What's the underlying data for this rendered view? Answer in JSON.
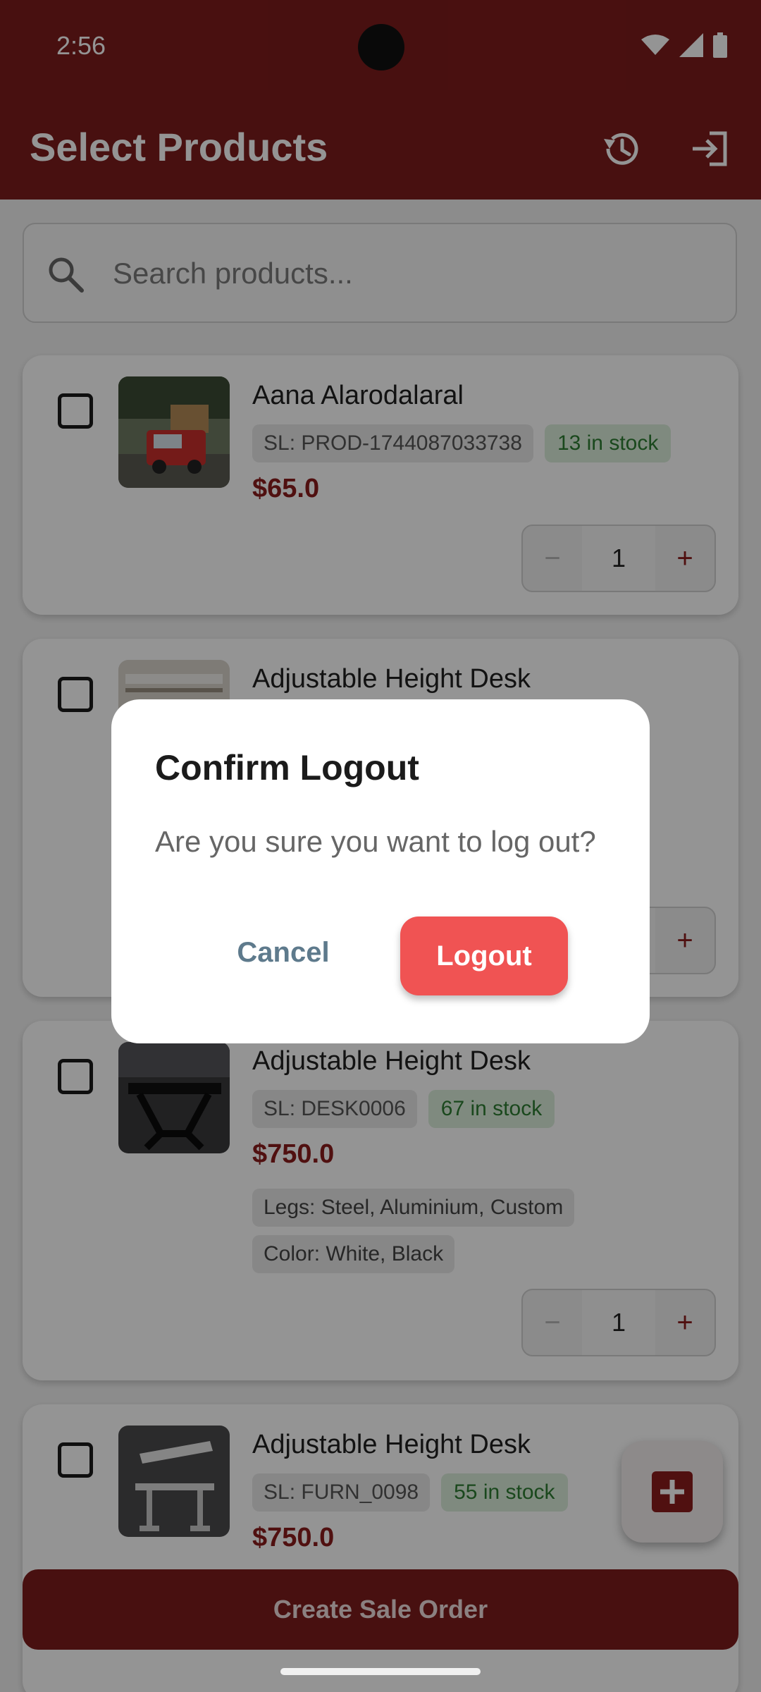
{
  "status_bar": {
    "time": "2:56"
  },
  "app_bar": {
    "title": "Select Products",
    "history_icon": "history-icon",
    "logout_icon": "logout-icon"
  },
  "search": {
    "placeholder": "Search products..."
  },
  "products": [
    {
      "name": "Aana Alarodalaral",
      "sl": "SL: PROD-1744087033738",
      "stock": "13 in stock",
      "price": "$65.0",
      "quantity": "1",
      "attributes": []
    },
    {
      "name": "Adjustable Height Desk",
      "sl": "",
      "stock": "",
      "price": "",
      "quantity": "",
      "attributes": []
    },
    {
      "name": "Adjustable Height Desk",
      "sl": "SL: DESK0006",
      "stock": "67 in stock",
      "price": "$750.0",
      "quantity": "1",
      "attributes": [
        "Legs: Steel, Aluminium, Custom",
        "Color: White, Black"
      ]
    },
    {
      "name": "Adjustable Height Desk",
      "sl": "SL: FURN_0098",
      "stock": "55 in stock",
      "price": "$750.0",
      "quantity": "",
      "attributes": []
    }
  ],
  "qty_controls": {
    "minus": "−",
    "plus": "+"
  },
  "fab": {
    "icon": "add-box-icon"
  },
  "bottom_button": {
    "label": "Create Sale Order"
  },
  "dialog": {
    "title": "Confirm Logout",
    "message": "Are you sure you want to log out?",
    "cancel_label": "Cancel",
    "confirm_label": "Logout"
  },
  "colors": {
    "primary": "#7d1c1c",
    "price": "#8b1c1c",
    "stock_text": "#2e7d32",
    "logout_button": "#f05353",
    "cancel_text": "#5e7a8c"
  }
}
